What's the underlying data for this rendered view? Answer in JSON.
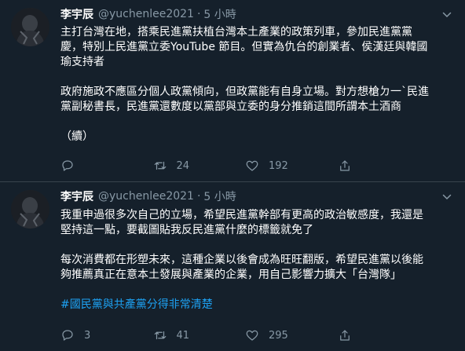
{
  "tweets": [
    {
      "author_name": "李宇辰",
      "handle": "@yuchenlee2021",
      "separator": "·",
      "time": "5 小時",
      "text_lines": [
        "主打台灣在地，搭乘民進黨扶植台灣本土產業的政策列車，參加民進黨黨",
        "慶，特別上民進黨立委YouTube 節目。但實為仇台的創業者、侯漢廷與韓國",
        "瑜支持者",
        "",
        "政府施政不應區分個人政黨傾向，但政黨能有自身立場。對方想槍ㄉ一ˋ民進",
        "黨副秘書長，民進黨還數度以黨部與立委的身分推銷這間所謂本土酒商",
        "",
        "（續）"
      ],
      "hashtag": "",
      "actions": {
        "reply": "",
        "retweet": "24",
        "like": "192",
        "share": ""
      }
    },
    {
      "author_name": "李宇辰",
      "handle": "@yuchenlee2021",
      "separator": "·",
      "time": "5 小時",
      "text_lines": [
        "我重申過很多次自己的立場，希望民進黨幹部有更高的政治敏感度，我還是",
        "堅持這一點，要截圖貼我反民進黨什麼的標籤就免了",
        "",
        "每次消費都在形塑未來，這種企業以後會成為旺旺翻版，希望民進黨以後能",
        "夠推薦真正在意本土發展與產業的企業，用自己影響力擴大「台灣隊」"
      ],
      "hashtag": "#國民黨與共產黨分得非常清楚",
      "actions": {
        "reply": "3",
        "retweet": "41",
        "like": "295",
        "share": ""
      }
    }
  ],
  "colors": {
    "background": "#15202b",
    "text": "#ffffff",
    "secondary": "#8899a6",
    "link": "#1da1f2",
    "divider": "#38444d"
  },
  "icons": {
    "reply": "reply-icon",
    "retweet": "retweet-icon",
    "like": "heart-icon",
    "share": "share-icon",
    "more": "more-options-icon"
  }
}
